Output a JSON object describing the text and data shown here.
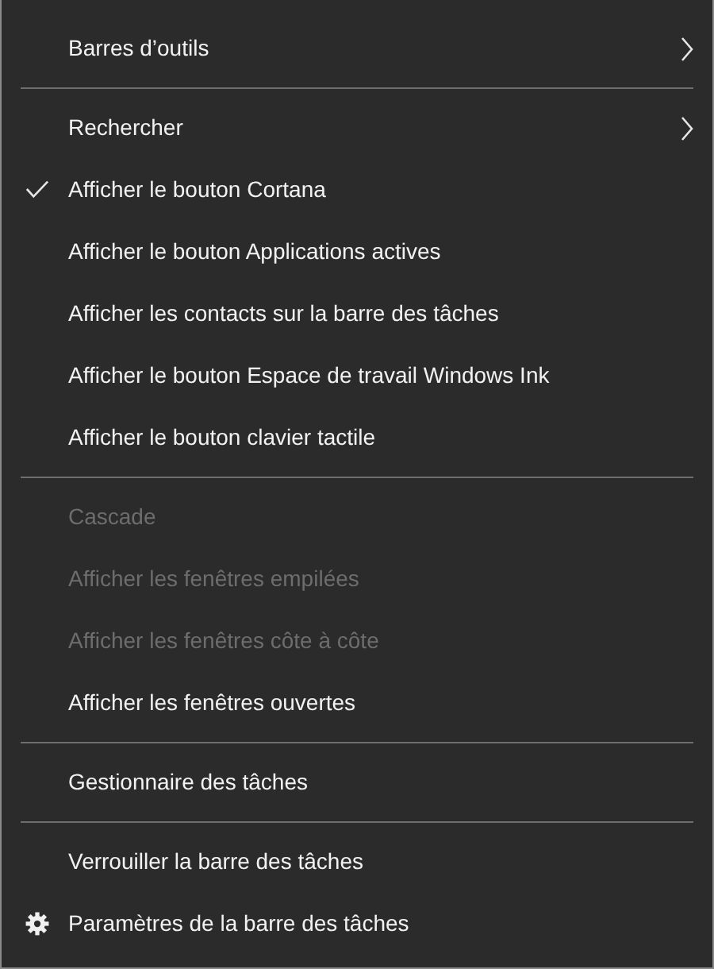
{
  "menu": [
    {
      "kind": "item",
      "label": "Barres d’outils",
      "checked": false,
      "disabled": false,
      "submenu": true
    },
    {
      "kind": "separator"
    },
    {
      "kind": "item",
      "label": "Rechercher",
      "checked": false,
      "disabled": false,
      "submenu": true
    },
    {
      "kind": "item",
      "label": "Afficher le bouton Cortana",
      "checked": true,
      "disabled": false,
      "submenu": false
    },
    {
      "kind": "item",
      "label": "Afficher le bouton Applications actives",
      "checked": false,
      "disabled": false,
      "submenu": false
    },
    {
      "kind": "item",
      "label": "Afficher les contacts sur la barre des tâches",
      "checked": false,
      "disabled": false,
      "submenu": false
    },
    {
      "kind": "item",
      "label": "Afficher le bouton Espace de travail Windows Ink",
      "checked": false,
      "disabled": false,
      "submenu": false
    },
    {
      "kind": "item",
      "label": "Afficher le bouton clavier tactile",
      "checked": false,
      "disabled": false,
      "submenu": false
    },
    {
      "kind": "separator"
    },
    {
      "kind": "item",
      "label": "Cascade",
      "checked": false,
      "disabled": true,
      "submenu": false
    },
    {
      "kind": "item",
      "label": "Afficher les fenêtres empilées",
      "checked": false,
      "disabled": true,
      "submenu": false
    },
    {
      "kind": "item",
      "label": "Afficher les fenêtres côte à côte",
      "checked": false,
      "disabled": true,
      "submenu": false
    },
    {
      "kind": "item",
      "label": "Afficher les fenêtres ouvertes",
      "checked": false,
      "disabled": false,
      "submenu": false
    },
    {
      "kind": "separator"
    },
    {
      "kind": "item",
      "label": "Gestionnaire des tâches",
      "checked": false,
      "disabled": false,
      "submenu": false
    },
    {
      "kind": "separator"
    },
    {
      "kind": "item",
      "label": "Verrouiller la barre des tâches",
      "checked": false,
      "disabled": false,
      "submenu": false
    },
    {
      "kind": "settings",
      "label": "Paramètres de la barre des tâches"
    }
  ]
}
